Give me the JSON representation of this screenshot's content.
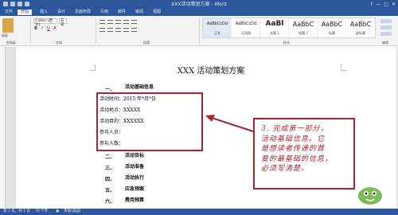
{
  "window": {
    "title": "XXX活动策划方案 - Word",
    "controls": [
      "?",
      "—",
      "□",
      "✕"
    ]
  },
  "ribbon": {
    "file_tab": "文件",
    "tabs": [
      "开始",
      "插入",
      "设计",
      "页面布局",
      "引用",
      "邮件",
      "审阅",
      "视图"
    ],
    "active_tab_index": 0,
    "paste_label": "粘贴",
    "font_name": "Calibri (西文)",
    "font_size": "五号",
    "format_buttons": [
      "B",
      "I",
      "U",
      "A"
    ],
    "styles": [
      {
        "sample": "AaBbCcDd",
        "name": "正文"
      },
      {
        "sample": "AaBbCcDd",
        "name": "无间隔"
      },
      {
        "sample": "AaBl",
        "name": "标题 1"
      },
      {
        "sample": "AaBbC",
        "name": "标题 2"
      },
      {
        "sample": "AaBbC",
        "name": "标题"
      },
      {
        "sample": "AaBbC",
        "name": "副标题"
      }
    ],
    "group_labels": [
      "剪贴板",
      "字体",
      "段落",
      "样式",
      "编辑"
    ]
  },
  "document": {
    "title": "XXX 活动策划方案",
    "section1": {
      "num": "一、",
      "heading": "活动基础信息"
    },
    "info_lines": [
      "活动时间：2015 年*月*日",
      "活动地点：XXXXX",
      "活动目的：XXXXXX",
      "参与人员：",
      "参与人数："
    ],
    "sections": [
      {
        "num": "二、",
        "heading": "活动目标"
      },
      {
        "num": "三、",
        "heading": "活动准备"
      },
      {
        "num": "四、",
        "heading": "活动执行"
      },
      {
        "num": "五、",
        "heading": "应急预案"
      },
      {
        "num": "六、",
        "heading": "费用预算"
      }
    ],
    "annotation": [
      "3. 完成第一部分，",
      "活动基础信息。它",
      "是想读者传递的首",
      "要的最基础的信息，",
      "必须写清楚。"
    ]
  },
  "status": {
    "page": "第 1 页，共 1 页",
    "words": "76 个字",
    "language": "英语(美国)"
  },
  "colors": {
    "accent": "#2b579a",
    "annotation": "#a62732"
  }
}
